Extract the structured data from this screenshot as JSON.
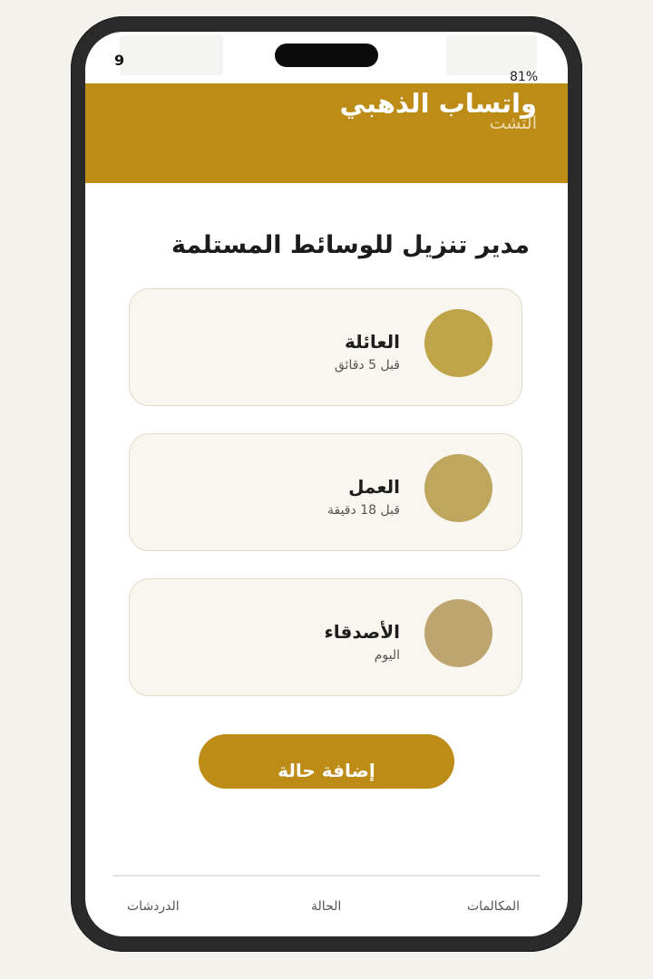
{
  "status_bar": {
    "time": "9",
    "battery": "81%"
  },
  "header": {
    "title": "واتساب الذهبي",
    "subtitle": "التشت"
  },
  "page_title": "مدير تنزيل للوسائط المستلمة",
  "status_items": [
    {
      "name": "العائلة",
      "time": "قبل 5 دقائق",
      "avatar_color": "#bfa44a"
    },
    {
      "name": "العمل",
      "time": "قبل 18 دقيقة",
      "avatar_color": "#bea65e"
    },
    {
      "name": "الأصدقاء",
      "time": "اليوم",
      "avatar_color": "#bea570"
    }
  ],
  "add_button_label": "إضافة حالة",
  "bottom_nav": {
    "chats": "الدردشات",
    "status": "الحالة",
    "calls": "المكالمات"
  },
  "colors": {
    "accent": "#bd8c17",
    "card_bg": "#f8f6ef",
    "card_border": "#dedbc9"
  }
}
